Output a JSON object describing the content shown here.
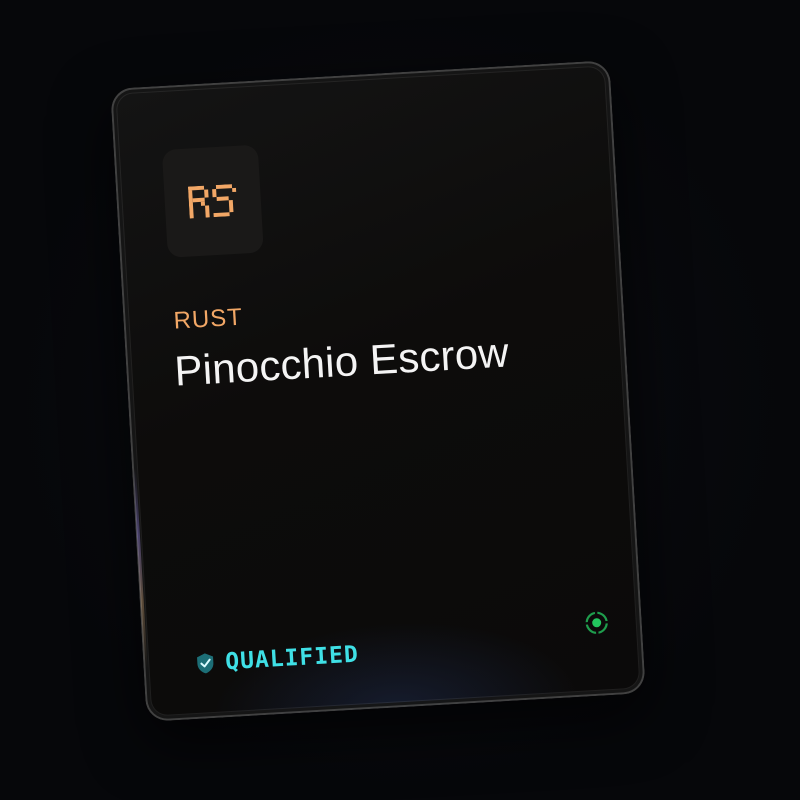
{
  "card": {
    "logo": {
      "text": "RS",
      "icon": "rust-logo-icon",
      "color": "#f2a766"
    },
    "category": "RUST",
    "title": "Pinocchio Escrow",
    "status": {
      "label": "QUALIFIED",
      "icon": "check-shield-icon",
      "color": "#3fe0e6"
    },
    "indicator": {
      "icon": "target-icon",
      "color": "#22c55e"
    }
  }
}
